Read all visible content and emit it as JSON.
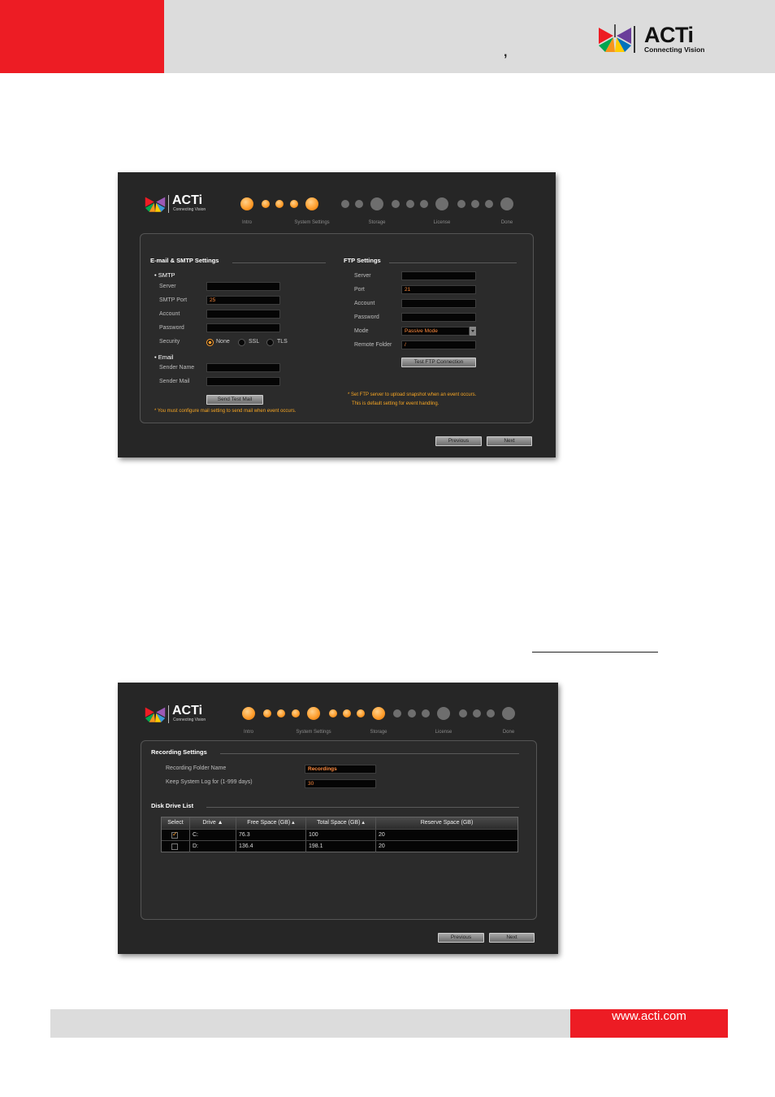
{
  "header": {
    "comma": ",",
    "brand_name": "ACTi",
    "brand_tagline": "Connecting Vision",
    "colors": {
      "red": "#ed1c24",
      "gray": "#dcdcdc"
    }
  },
  "wizard": {
    "logo_name": "ACTi",
    "logo_tagline": "Connecting Vision",
    "steps": [
      "Intro",
      "System Settings",
      "Storage",
      "License",
      "Done"
    ],
    "accent": "#ff9f2f"
  },
  "shot1": {
    "email_section": "E-mail & SMTP Settings",
    "smtp_heading": "SMTP",
    "server_label": "Server",
    "server_value": "",
    "smtp_port_label": "SMTP Port",
    "smtp_port_value": "25",
    "account_label": "Account",
    "password_label": "Password",
    "security_label": "Security",
    "security_options": [
      "None",
      "SSL",
      "TLS"
    ],
    "security_selected": "None",
    "email_heading": "Email",
    "sender_name_label": "Sender Name",
    "sender_mail_label": "Sender Mail",
    "send_test_button": "Send Test Mail",
    "mail_note": "* You must configure mail setting to send mail when event occurs.",
    "ftp_section": "FTP Settings",
    "ftp_server_label": "Server",
    "ftp_port_label": "Port",
    "ftp_port_value": "21",
    "ftp_account_label": "Account",
    "ftp_password_label": "Password",
    "mode_label": "Mode",
    "mode_value": "Passive Mode",
    "remote_folder_label": "Remote Folder",
    "remote_folder_value": "/",
    "test_ftp_button": "Test FTP Connection",
    "ftp_note_1": "* Set FTP server to upload snapshot when an event occurs.",
    "ftp_note_2": "This is default setting for event handling.",
    "previous_button": "Previous",
    "next_button": "Next"
  },
  "shot2": {
    "recording_section": "Recording Settings",
    "folder_name_label": "Recording Folder Name",
    "folder_name_value": "Recordings",
    "keep_log_label": "Keep System Log for (1-999 days)",
    "keep_log_value": "30",
    "disk_section": "Disk Drive List",
    "columns": [
      "Select",
      "Drive",
      "Free Space (GB)",
      "Total Space (GB)",
      "Reserve Space (GB)"
    ],
    "rows": [
      {
        "selected": true,
        "drive": "C:",
        "free": "76.3",
        "total": "100",
        "reserve": "20"
      },
      {
        "selected": false,
        "drive": "D:",
        "free": "136.4",
        "total": "198.1",
        "reserve": "20"
      }
    ],
    "previous_button": "Previous",
    "next_button": "Next"
  },
  "footer": {
    "url": "www.acti.com"
  }
}
